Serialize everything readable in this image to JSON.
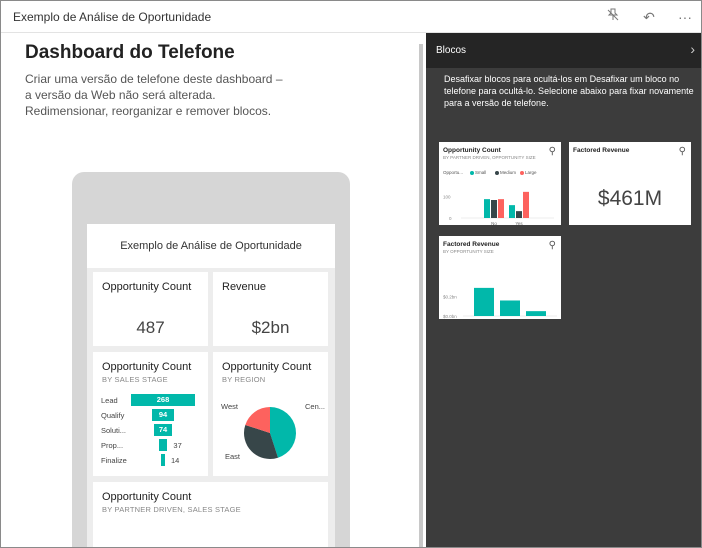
{
  "window": {
    "title": "Exemplo de Análise de Oportunidade"
  },
  "titlebar_icons": {
    "pin": "unpin-icon",
    "undo": "undo-icon",
    "more": "more-icon",
    "more_glyph": "···",
    "undo_glyph": "↶",
    "pin_glyph": "⚲"
  },
  "main": {
    "heading": "Dashboard do Telefone",
    "description_line1": "Criar uma versão de telefone deste dashboard –",
    "description_line2": "a versão da Web não será alterada.",
    "description_line3": "Redimensionar, reorganizar e remover blocos."
  },
  "phone": {
    "header": "Exemplo de Análise de Oportunidade",
    "tiles": {
      "opp_count": {
        "title": "Opportunity Count",
        "value": "487"
      },
      "revenue": {
        "title": "Revenue",
        "value": "$2bn"
      },
      "opp_stage": {
        "title": "Opportunity Count",
        "subtitle": "BY SALES STAGE",
        "funnel": [
          {
            "label": "Lead",
            "value": "268",
            "fraction": 1.0
          },
          {
            "label": "Qualify",
            "value": "94",
            "fraction": 0.35
          },
          {
            "label": "Soluti...",
            "value": "74",
            "fraction": 0.276
          },
          {
            "label": "Prop...",
            "value": "37",
            "fraction": 0.138
          },
          {
            "label": "Finalize",
            "value": "14",
            "fraction": 0.052
          }
        ]
      },
      "opp_region": {
        "title": "Opportunity Count",
        "subtitle": "BY REGION",
        "labels": {
          "west": "West",
          "central": "Cen...",
          "east": "East"
        },
        "slices": [
          {
            "name": "Central",
            "fraction": 0.45,
            "color": "#01b8aa"
          },
          {
            "name": "East",
            "fraction": 0.35,
            "color": "#374649"
          },
          {
            "name": "West",
            "fraction": 0.2,
            "color": "#fd625e"
          }
        ]
      },
      "opp_partner": {
        "title": "Opportunity Count",
        "subtitle": "BY PARTNER DRIVEN, SALES STAGE"
      }
    }
  },
  "panel": {
    "title": "Blocos",
    "description": "Desafixar blocos para ocultá-los em Desafixar um bloco no telefone para ocultá-lo. Selecione abaixo para fixar novamente para a versão de telefone.",
    "tiles": {
      "tile1": {
        "title": "Opportunity Count",
        "subtitle": "BY PARTNER DRIVEN, OPPORTUNITY SIZE",
        "legend_title": "Opportu...",
        "legend": [
          {
            "name": "Small",
            "color": "#01b8aa"
          },
          {
            "name": "Medium",
            "color": "#374649"
          },
          {
            "name": "Large",
            "color": "#fd625e"
          }
        ],
        "y_tick_top": "100",
        "y_tick_bottom": "0",
        "categories": [
          "No",
          "Yes"
        ],
        "values": {
          "No": [
            88,
            84,
            88
          ],
          "Yes": [
            60,
            32,
            122
          ]
        },
        "ymax": 140
      },
      "tile2": {
        "title": "Factored Revenue",
        "value": "$461M"
      },
      "tile3": {
        "title": "Factored Revenue",
        "subtitle": "BY OPPORTUNITY SIZE",
        "y_tick_top": "$0.2bn",
        "y_tick_bottom": "$0.0bn",
        "categories": [
          "Large",
          "Medium",
          "Small"
        ],
        "values": [
          0.29,
          0.16,
          0.05
        ],
        "ymax": 0.33,
        "color": "#01b8aa"
      }
    }
  },
  "colors": {
    "accent": "#01b8aa",
    "dark": "#374649",
    "red": "#fd625e",
    "panel_bg": "#3c3c3c",
    "panel_header": "#252525"
  }
}
